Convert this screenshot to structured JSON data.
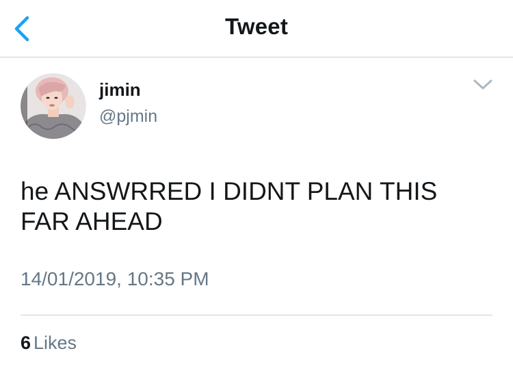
{
  "navbar": {
    "title": "Tweet",
    "back_icon": "chevron-left-icon",
    "accent_color": "#1da1f2"
  },
  "tweet": {
    "author": {
      "display_name": "jimin",
      "handle": "@pjmin",
      "avatar_icon": "avatar"
    },
    "text": "he ANSWRRED I DIDNT PLAN THIS FAR AHEAD",
    "timestamp": "14/01/2019, 10:35 PM",
    "stats": {
      "likes_count": "6",
      "likes_label": "Likes"
    },
    "menu_icon": "chevron-down-icon"
  }
}
